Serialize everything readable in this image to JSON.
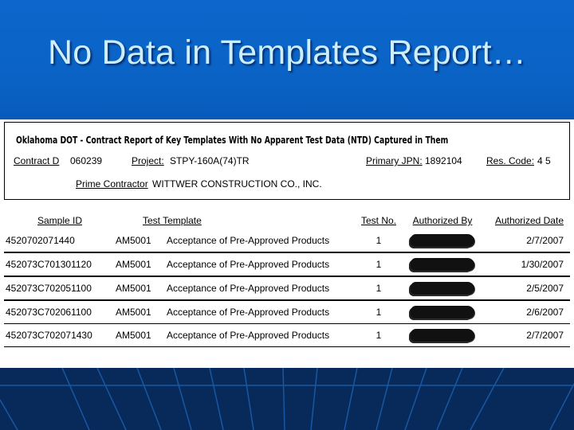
{
  "slide": {
    "title": "No Data in Templates Report…"
  },
  "report": {
    "title": "Oklahoma DOT -   Contract Report of  Key Templates With No Apparent Test Data (NTD) Captured in Them",
    "fields": {
      "contract_id_label": "Contract  D",
      "contract_id_value": "060239",
      "project_label": "Project:",
      "project_value": "STPY-160A(74)TR",
      "primary_jpn_label": "Primary JPN:",
      "primary_jpn_value": "1892104",
      "res_code_label": "Res. Code:",
      "res_code_value": "4  5",
      "prime_contractor_label": "Prime Contractor",
      "prime_contractor_value": "WITTWER CONSTRUCTION CO., INC."
    },
    "columns": {
      "sample_id": "Sample ID",
      "test_template": "Test Template",
      "test_no": "Test No.",
      "authorized_by": "Authorized By",
      "authorized_date": "Authorized Date"
    },
    "rows": [
      {
        "sample_id": "4520702071440",
        "code": "AM5001",
        "template": "Acceptance of Pre-Approved Products",
        "test_no": "1",
        "authorized_by": "[redacted]",
        "date": "2/7/2007"
      },
      {
        "sample_id": "452073C701301120",
        "code": "AM5001",
        "template": "Acceptance of Pre-Approved Products",
        "test_no": "1",
        "authorized_by": "[redacted]",
        "date": "1/30/2007"
      },
      {
        "sample_id": "452073C702051100",
        "code": "AM5001",
        "template": "Acceptance of Pre-Approved Products",
        "test_no": "1",
        "authorized_by": "[redacted]",
        "date": "2/5/2007"
      },
      {
        "sample_id": "452073C702061100",
        "code": "AM5001",
        "template": "Acceptance of Pre-Approved Products",
        "test_no": "1",
        "authorized_by": "[redacted]",
        "date": "2/6/2007"
      },
      {
        "sample_id": "452073C702071430",
        "code": "AM5001",
        "template": "Acceptance of Pre-Approved Products",
        "test_no": "1",
        "authorized_by": "[redacted]",
        "date": "2/7/2007"
      }
    ]
  },
  "colors": {
    "title_text": "#cfeefc",
    "background_top": "#0b64c8",
    "background_bottom": "#082a5a"
  }
}
